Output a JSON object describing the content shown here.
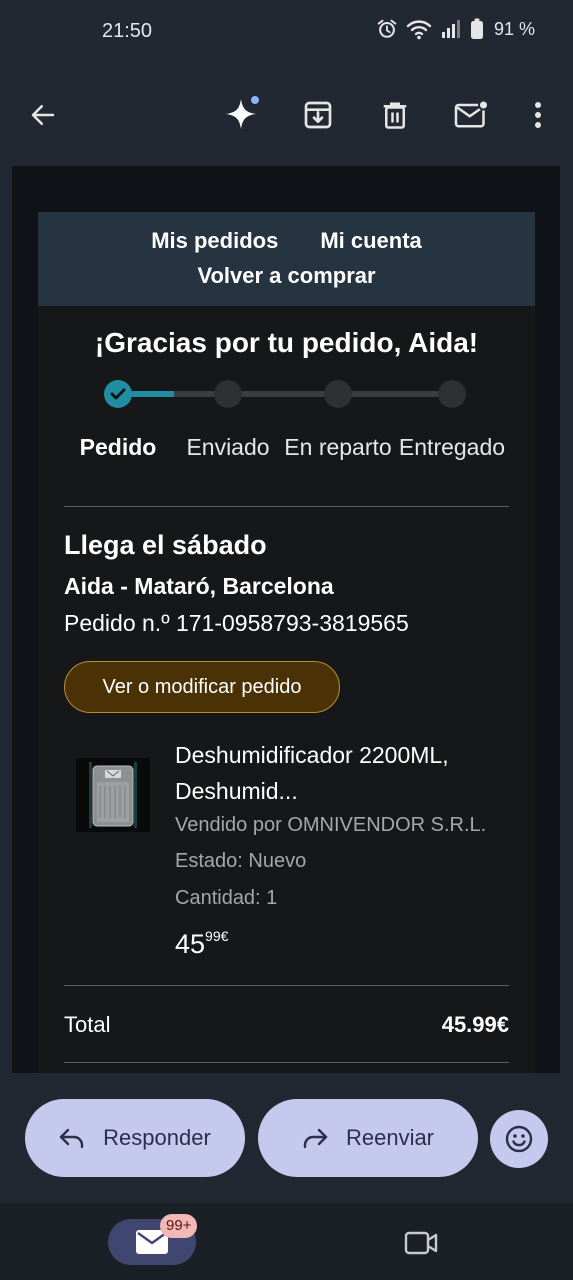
{
  "status_bar": {
    "time": "21:50",
    "battery": "91 %",
    "icons": [
      "alarm-icon",
      "wifi-icon",
      "signal-icon",
      "battery-icon"
    ]
  },
  "toolbar": {
    "icons": [
      "back-arrow-icon",
      "gemini-sparkle-icon",
      "archive-icon",
      "delete-icon",
      "mark-unread-icon",
      "more-vert-icon"
    ]
  },
  "email": {
    "nav": {
      "my_orders": "Mis pedidos",
      "my_account": "Mi cuenta",
      "buy_again": "Volver a comprar"
    },
    "thanks": "¡Gracias por tu pedido, Aida!",
    "tracker": {
      "steps": [
        "Pedido",
        "Enviado",
        "En reparto",
        "Entregado"
      ],
      "current_step": 0
    },
    "delivery": {
      "arrives": "Llega el sábado",
      "address": "Aida - Mataró, Barcelona",
      "order_number": "Pedido n.º 171-0958793-3819565"
    },
    "modify_button": "Ver o modificar pedido",
    "product": {
      "title": "Deshumidificador 2200ML, Deshumid...",
      "seller": "Vendido por OMNIVENDOR S.R.L.",
      "condition": "Estado: Nuevo",
      "quantity": "Cantidad: 1",
      "price_int": "45",
      "price_dec": "99€"
    },
    "total": {
      "label": "Total",
      "value": "45.99€"
    }
  },
  "actions": {
    "reply": "Responder",
    "forward": "Reenviar",
    "emoji_icon": "emoji-icon"
  },
  "bottom_nav": {
    "mail_badge": "99+",
    "icons": [
      "mail-icon",
      "video-icon"
    ]
  },
  "colors": {
    "accent": "#1f8ea3",
    "button_bg": "#4a3206",
    "pill_bg": "#c6c9ee",
    "badge_bg": "#f2b8b5"
  }
}
